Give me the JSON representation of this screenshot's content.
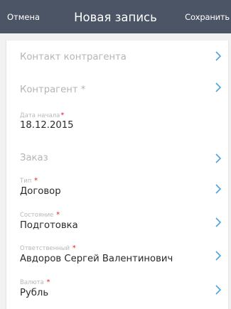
{
  "header": {
    "cancel_label": "Отмена",
    "title": "Новая запись",
    "save_label": "Сохранить"
  },
  "form": {
    "contact": {
      "placeholder": "Контакт контрагента"
    },
    "counterparty": {
      "placeholder": "Контрагент",
      "required": "*"
    },
    "start_date": {
      "label": "Дата начала",
      "required": "*",
      "value": "18.12.2015"
    },
    "order": {
      "placeholder": "Заказ"
    },
    "type": {
      "label": "Тип",
      "required": "*",
      "value": "Договор"
    },
    "state": {
      "label": "Состояние",
      "required": "*",
      "value": "Подготовка"
    },
    "responsible": {
      "label": "Ответственный",
      "required": "*",
      "value": "Авдоров Сергей Валентинович"
    },
    "currency": {
      "label": "Валюта",
      "required": "*",
      "value": "Рубль"
    }
  },
  "colors": {
    "header_bg": "#4b5565",
    "chevron": "#4aa3df",
    "required_star": "#e0202a"
  },
  "icons": {
    "row_arrow": "chevron-right-icon"
  }
}
